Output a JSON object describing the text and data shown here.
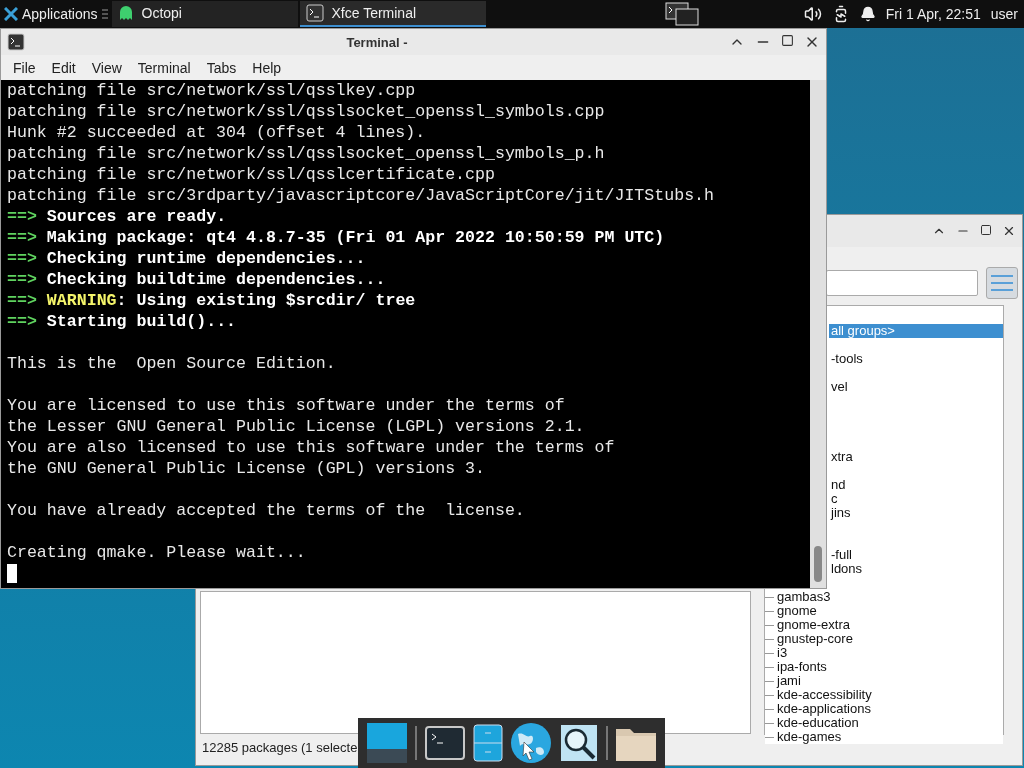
{
  "panel": {
    "apps_label": "Applications",
    "tasks": [
      {
        "label": "Octopi",
        "kind": "ghost",
        "selected": false
      },
      {
        "label": "Xfce Terminal",
        "kind": "terminal",
        "selected": true
      }
    ],
    "clock": "Fri  1 Apr, 22:51",
    "user": "user"
  },
  "terminal": {
    "title": "Terminal -",
    "menu": [
      "File",
      "Edit",
      "View",
      "Terminal",
      "Tabs",
      "Help"
    ],
    "lines": [
      {
        "kind": "plain",
        "text": "patching file src/network/ssl/qsslkey.cpp"
      },
      {
        "kind": "plain",
        "text": "patching file src/network/ssl/qsslsocket_openssl_symbols.cpp"
      },
      {
        "kind": "plain",
        "text": "Hunk #2 succeeded at 304 (offset 4 lines)."
      },
      {
        "kind": "plain",
        "text": "patching file src/network/ssl/qsslsocket_openssl_symbols_p.h"
      },
      {
        "kind": "plain",
        "text": "patching file src/network/ssl/qsslcertificate.cpp"
      },
      {
        "kind": "plain",
        "text": "patching file src/3rdparty/javascriptcore/JavaScriptCore/jit/JITStubs.h"
      },
      {
        "kind": "status",
        "marker": "==>",
        "text": "Sources are ready."
      },
      {
        "kind": "status",
        "marker": "==>",
        "text": "Making package: qt4 4.8.7-35 (Fri 01 Apr 2022 10:50:59 PM UTC)"
      },
      {
        "kind": "status",
        "marker": "==>",
        "text": "Checking runtime dependencies..."
      },
      {
        "kind": "status",
        "marker": "==>",
        "text": "Checking buildtime dependencies..."
      },
      {
        "kind": "warning",
        "marker": "==>",
        "label": "WARNING",
        "text": ": Using existing $srcdir/ tree"
      },
      {
        "kind": "status",
        "marker": "==>",
        "text": "Starting build()..."
      },
      {
        "kind": "blank"
      },
      {
        "kind": "plain",
        "text": "This is the  Open Source Edition."
      },
      {
        "kind": "blank"
      },
      {
        "kind": "plain",
        "text": "You are licensed to use this software under the terms of"
      },
      {
        "kind": "plain",
        "text": "the Lesser GNU General Public License (LGPL) versions 2.1."
      },
      {
        "kind": "plain",
        "text": "You are also licensed to use this software under the terms of"
      },
      {
        "kind": "plain",
        "text": "the GNU General Public License (GPL) versions 3."
      },
      {
        "kind": "blank"
      },
      {
        "kind": "plain",
        "text": "You have already accepted the terms of the  license."
      },
      {
        "kind": "blank"
      },
      {
        "kind": "plain",
        "text": "Creating qmake. Please wait..."
      }
    ]
  },
  "package_manager": {
    "groups": [
      {
        "label": "all groups>",
        "kind": "cut",
        "selected": true
      },
      {
        "label": "-tools",
        "kind": "cut",
        "selected": false
      },
      {
        "label": "vel",
        "kind": "cut",
        "selected": false
      },
      {
        "label": "xtra",
        "kind": "cut",
        "selected": false
      },
      {
        "label": "nd",
        "kind": "cut",
        "selected": false
      },
      {
        "label": "c",
        "kind": "cut",
        "selected": false
      },
      {
        "label": "jins",
        "kind": "cut",
        "selected": false
      },
      {
        "label": "-full",
        "kind": "cut",
        "selected": false
      },
      {
        "label": "ldons",
        "kind": "cut",
        "selected": false
      },
      {
        "label": "gambas3",
        "kind": "full",
        "selected": false
      },
      {
        "label": "gnome",
        "kind": "full",
        "selected": false
      },
      {
        "label": "gnome-extra",
        "kind": "full",
        "selected": false
      },
      {
        "label": "gnustep-core",
        "kind": "full",
        "selected": false
      },
      {
        "label": "i3",
        "kind": "full",
        "selected": false
      },
      {
        "label": "ipa-fonts",
        "kind": "full",
        "selected": false
      },
      {
        "label": "jami",
        "kind": "full",
        "selected": false
      },
      {
        "label": "kde-accessibility",
        "kind": "full",
        "selected": false
      },
      {
        "label": "kde-applications",
        "kind": "full",
        "selected": false
      },
      {
        "label": "kde-education",
        "kind": "full",
        "selected": false
      },
      {
        "label": "kde-games",
        "kind": "full",
        "selected": false
      }
    ],
    "status": "12285 packages (1 selecte"
  }
}
